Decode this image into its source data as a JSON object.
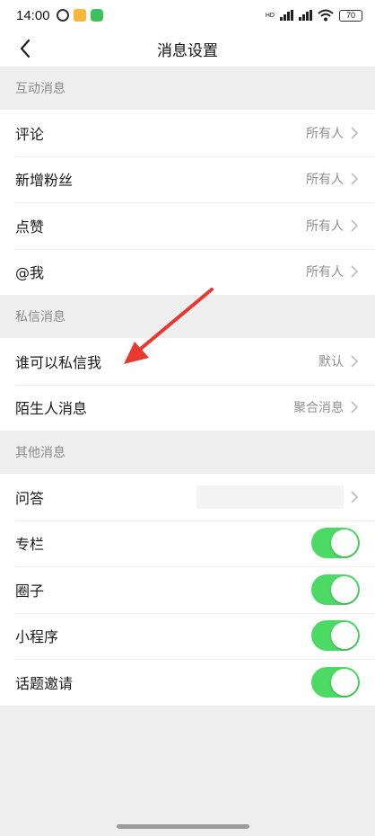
{
  "status_bar": {
    "time": "14:00",
    "battery": "70",
    "network_label": "HD"
  },
  "nav": {
    "title": "消息设置"
  },
  "sections": {
    "interaction": {
      "header": "互动消息",
      "rows": [
        {
          "label": "评论",
          "value": "所有人"
        },
        {
          "label": "新增粉丝",
          "value": "所有人"
        },
        {
          "label": "点赞",
          "value": "所有人"
        },
        {
          "label": "@我",
          "value": "所有人"
        }
      ]
    },
    "private": {
      "header": "私信消息",
      "rows": [
        {
          "label": "谁可以私信我",
          "value": "默认"
        },
        {
          "label": "陌生人消息",
          "value": "聚合消息"
        }
      ]
    },
    "other": {
      "header": "其他消息",
      "rows": [
        {
          "label": "问答"
        },
        {
          "label": "专栏",
          "toggle": true
        },
        {
          "label": "圈子",
          "toggle": true
        },
        {
          "label": "小程序",
          "toggle": true
        },
        {
          "label": "话题邀请",
          "toggle": true
        }
      ]
    }
  },
  "colors": {
    "toggle_on": "#4cd964",
    "annotation_arrow": "#e8382f",
    "background": "#efefef"
  },
  "icons": {
    "back": "chevron-left-icon",
    "row_arrow": "chevron-right-icon"
  }
}
